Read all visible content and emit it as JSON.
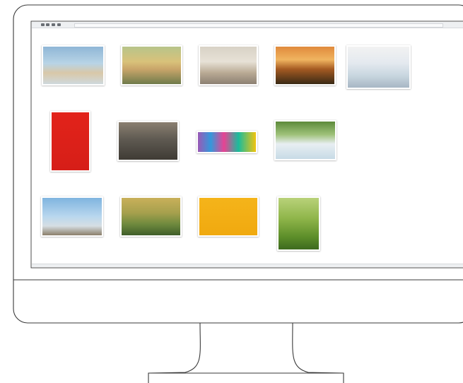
{
  "window": {
    "title": ""
  },
  "status_text": "",
  "thumbnails": [
    {
      "caption": "",
      "icon": "photo-beach-couple",
      "bg": "linear-gradient(180deg,#8fb6d6 0%,#b8d4e6 45%,#d9c8a8 70%,#cfd8dd 100%)"
    },
    {
      "caption": "",
      "icon": "photo-couple-sunset",
      "bg": "linear-gradient(180deg,#b7c48a 0%,#d9c27a 40%,#c9a56a 60%,#6f7b4b 100%)"
    },
    {
      "caption": "",
      "icon": "photo-woman-city",
      "bg": "linear-gradient(180deg,#d8d2c6 0%,#e7e1d6 40%,#b9aa94 70%,#8c8073 100%)"
    },
    {
      "caption": "",
      "icon": "photo-sunset-field",
      "bg": "linear-gradient(180deg,#e08a3c 0%,#f0b460 35%,#a55a22 60%,#3a2a15 100%)"
    },
    {
      "caption": "",
      "icon": "photo-woman-blossom",
      "bg": "linear-gradient(180deg,#f2f2f2 0%,#e4e9ef 40%,#c9d7e0 70%,#a7b6c4 100%)"
    },
    {
      "caption": "",
      "icon": "photo-jumping-red",
      "bg": "linear-gradient(180deg,#e2231a 0%,#d61e18 100%)"
    },
    {
      "caption": "",
      "icon": "photo-couple-street",
      "bg": "linear-gradient(180deg,#8a7f70 0%,#5f5a52 45%,#3f3b35 100%)"
    },
    {
      "caption": "",
      "icon": "photo-colorful-people",
      "bg": "linear-gradient(90deg,#9b59b6 0%,#3498db 22%,#e84393 45%,#1abc9c 70%,#f1c40f 100%)"
    },
    {
      "caption": "",
      "icon": "photo-swing-trees",
      "bg": "linear-gradient(180deg,#5c8a3a 0%,#9fc27a 35%,#e8eef2 60%,#c7dbe6 100%)"
    },
    {
      "caption": "",
      "icon": "photo-jump-sky",
      "bg": "linear-gradient(180deg,#7fb4df 0%,#b9d7ee 50%,#d6dee3 75%,#8c7f6a 100%)"
    },
    {
      "caption": "",
      "icon": "photo-family-park",
      "bg": "linear-gradient(180deg,#c9b05a 0%,#a6a04d 40%,#6f8a3e 70%,#3f5e2a 100%)"
    },
    {
      "caption": "",
      "icon": "photo-jump-yellow",
      "bg": "linear-gradient(180deg,#f5b41a 0%,#f0a90f 100%)"
    },
    {
      "caption": "",
      "icon": "photo-child-meadow",
      "bg": "linear-gradient(180deg,#b9d27a 0%,#8fb54a 40%,#5e8f2a 75%,#3d6a1e 100%)"
    }
  ]
}
